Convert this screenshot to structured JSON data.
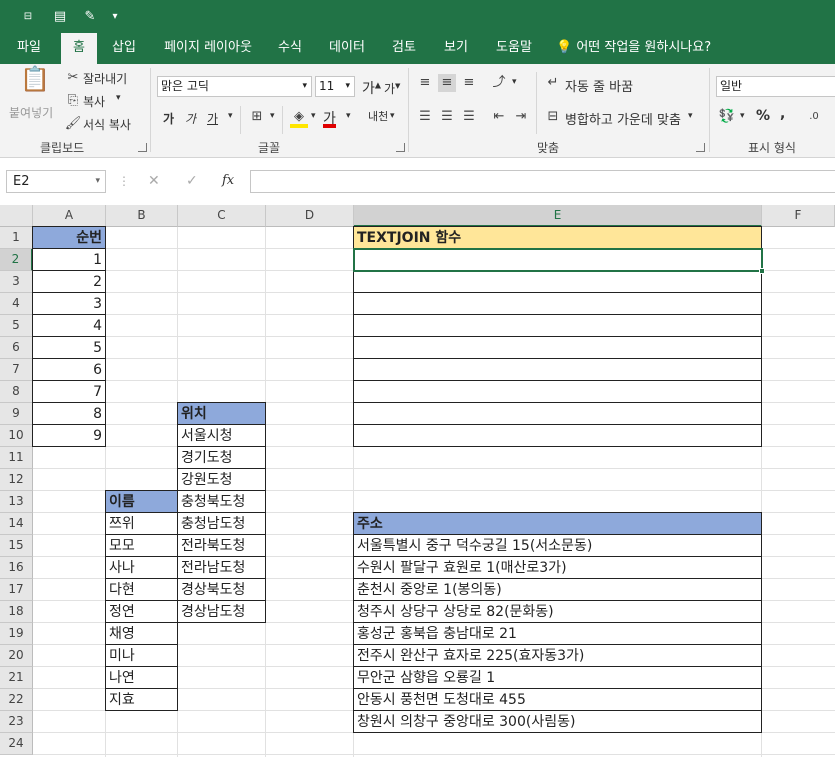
{
  "qat": {
    "autosave": "저장",
    "icon_save": "save-icon",
    "icon_brush": "brush-icon",
    "icon_more": "▾"
  },
  "tabs": [
    {
      "label": "파일"
    },
    {
      "label": "홈"
    },
    {
      "label": "삽입"
    },
    {
      "label": "페이지 레이아웃"
    },
    {
      "label": "수식"
    },
    {
      "label": "데이터"
    },
    {
      "label": "검토"
    },
    {
      "label": "보기"
    },
    {
      "label": "도움말"
    }
  ],
  "tell_me": "어떤 작업을 원하시나요?",
  "clipboard": {
    "paste": "붙여넣기",
    "cut": "잘라내기",
    "copy": "복사",
    "format_painter": "서식 복사",
    "group": "클립보드"
  },
  "font": {
    "name": "맑은 고딕",
    "size": "11",
    "group": "글꼴",
    "bold": "가",
    "italic": "가",
    "underline": "가",
    "grow": "가",
    "shrink": "가",
    "color_letter": "가",
    "phonetic": "내천"
  },
  "alignment": {
    "wrap": "자동 줄 바꿈",
    "merge": "병합하고 가운데 맞춤",
    "group": "맞춤"
  },
  "number": {
    "format": "일반",
    "group": "표시 형식",
    "percent": "%",
    "comma": ","
  },
  "formula_bar": {
    "cell_ref": "E2",
    "cancel": "✕",
    "enter": "✓",
    "fx": "fx",
    "content": ""
  },
  "columns": [
    "A",
    "B",
    "C",
    "D",
    "E",
    "F"
  ],
  "rows": [
    "1",
    "2",
    "3",
    "4",
    "5",
    "6",
    "7",
    "8",
    "9",
    "10",
    "11",
    "12",
    "13",
    "14",
    "15",
    "16",
    "17",
    "18",
    "19",
    "20",
    "21",
    "22",
    "23",
    "24"
  ],
  "sheet": {
    "col_a_header": "순번",
    "numbers": [
      "1",
      "2",
      "3",
      "4",
      "5",
      "6",
      "7",
      "8",
      "9"
    ],
    "col_b_header": "이름",
    "names": [
      "쯔위",
      "모모",
      "사나",
      "다현",
      "정연",
      "채영",
      "미나",
      "나연",
      "지효"
    ],
    "col_c_header": "위치",
    "locations": [
      "서울시청",
      "경기도청",
      "강원도청",
      "충청북도청",
      "충청남도청",
      "전라북도청",
      "전라남도청",
      "경상북도청",
      "경상남도청"
    ],
    "textjoin_header": "TEXTJOIN 함수",
    "address_header": "주소",
    "addresses": [
      "서울특별시 중구 덕수궁길 15(서소문동)",
      "수원시 팔달구 효원로 1(매산로3가)",
      "춘천시 중앙로 1(봉의동)",
      "청주시 상당구 상당로 82(문화동)",
      "홍성군 홍북읍 충남대로 21",
      "전주시 완산구 효자로 225(효자동3가)",
      "무안군 삼향읍 오룡길 1",
      "안동시 풍천면 도청대로 455",
      "창원시 의창구 중앙대로 300(사림동)"
    ]
  },
  "colors": {
    "excel_green": "#217346",
    "header_blue": "#8ea9db",
    "header_yellow": "#ffe699"
  }
}
